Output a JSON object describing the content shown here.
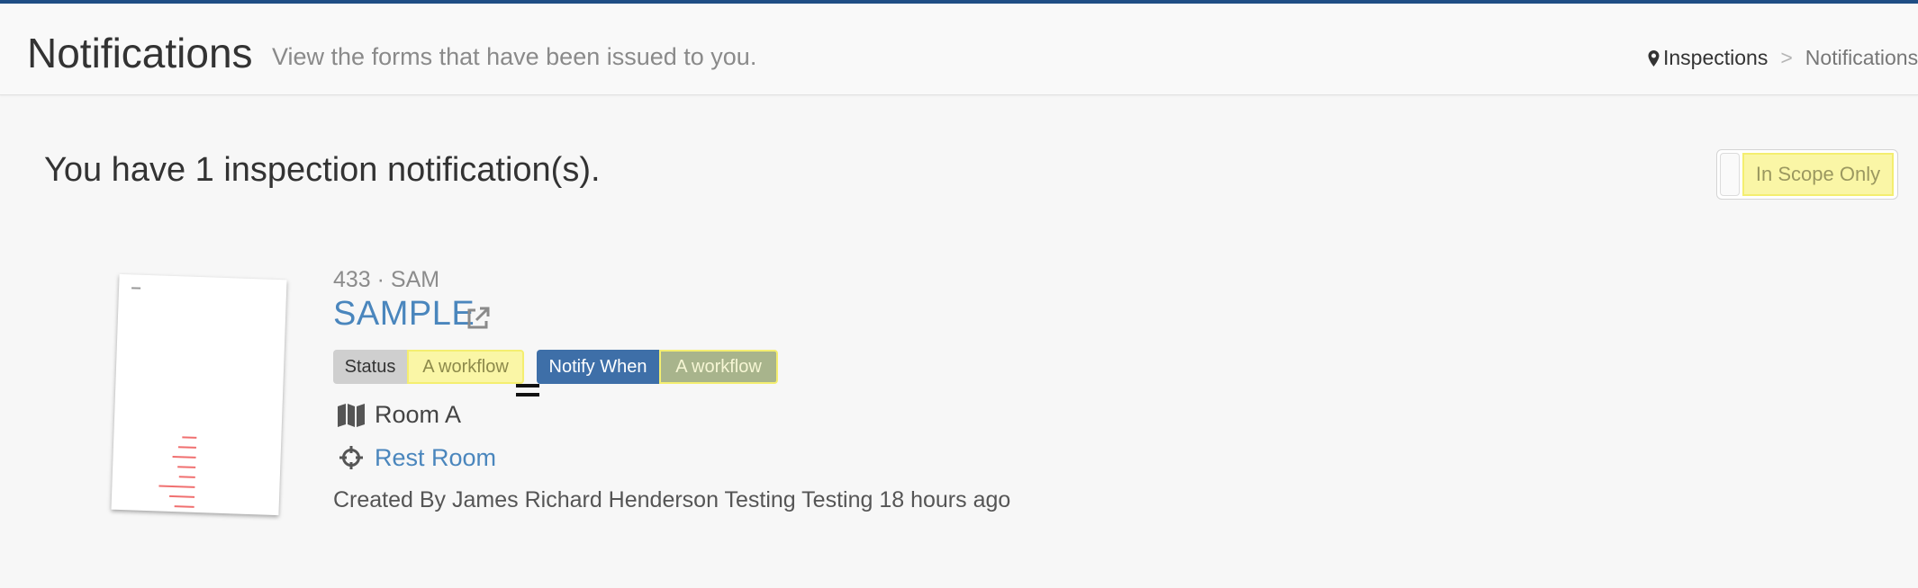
{
  "header": {
    "title": "Notifications",
    "subtitle": "View the forms that have been issued to you.",
    "breadcrumb": {
      "root": "Inspections",
      "separator": ">",
      "current": "Notifications"
    }
  },
  "summary": "You have 1 inspection notification(s).",
  "scope_toggle": {
    "label": "In Scope Only",
    "checked": false
  },
  "notification": {
    "code_line": "433 · SAM",
    "title": "SAMPLE",
    "badges": {
      "status_label": "Status",
      "status_value": "A workflow",
      "notify_label": "Notify When",
      "notify_value": "A workflow"
    },
    "location": "Room A",
    "room": "Rest Room",
    "created": "Created By James Richard Henderson Testing Testing 18 hours ago"
  },
  "colors": {
    "accent": "#1f4e85",
    "link": "#4a86bd",
    "highlight": "#faf6a6",
    "badge_blue": "#3e6fa8"
  },
  "icons": [
    "map-marker-icon",
    "external-link-icon",
    "map-icon",
    "crosshairs-icon"
  ]
}
